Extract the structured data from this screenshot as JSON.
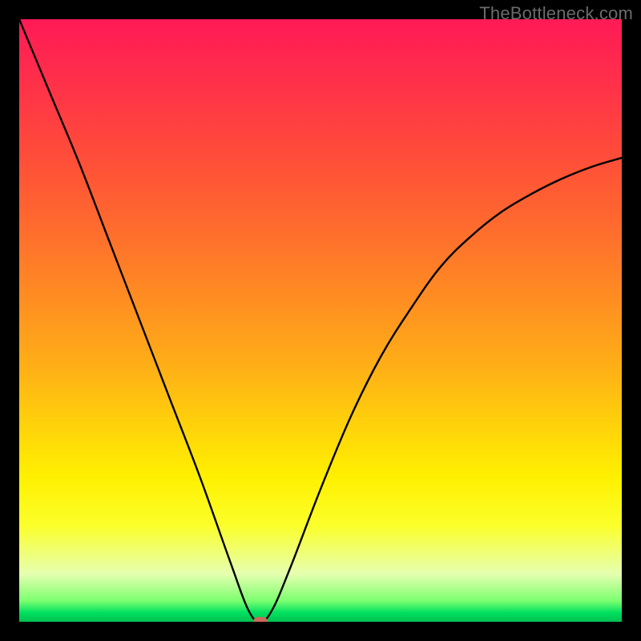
{
  "watermark": "TheBottleneck.com",
  "colors": {
    "frame_bg": "#000000",
    "curve_stroke": "#000000",
    "marker_fill": "#c96a5a",
    "gradient_stops": [
      "#ff1a56",
      "#ff2f4a",
      "#ff4b3a",
      "#ff6a2e",
      "#ff8c22",
      "#ffb016",
      "#ffd40a",
      "#fff000",
      "#fbff2a",
      "#e6ffb0",
      "#7dff70",
      "#00e060",
      "#00c050"
    ]
  },
  "chart_data": {
    "type": "line",
    "title": "",
    "xlabel": "",
    "ylabel": "",
    "xlim": [
      0,
      100
    ],
    "ylim": [
      0,
      100
    ],
    "grid": false,
    "legend": false,
    "series": [
      {
        "name": "bottleneck-curve",
        "x": [
          0,
          5,
          10,
          15,
          20,
          25,
          30,
          35,
          38,
          40,
          42,
          45,
          50,
          55,
          60,
          65,
          70,
          75,
          80,
          85,
          90,
          95,
          100
        ],
        "y": [
          100,
          88,
          76,
          63,
          50,
          37,
          24,
          10,
          2,
          0,
          2,
          9,
          22,
          34,
          44,
          52,
          59,
          64,
          68,
          71,
          73.5,
          75.5,
          77
        ]
      }
    ],
    "marker": {
      "x": 40,
      "y": 0,
      "semantic": "optimal-point"
    }
  }
}
